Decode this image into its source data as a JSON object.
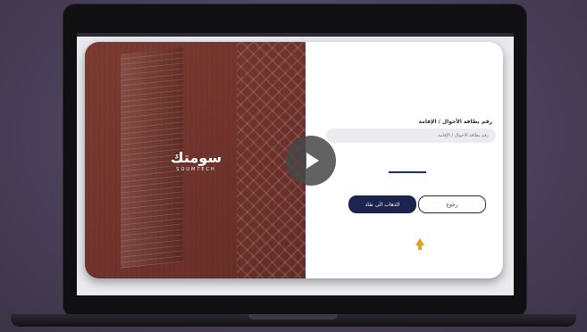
{
  "brand": {
    "name_ar": "سومتك",
    "name_en": "SOUMTECH"
  },
  "video": {
    "play_icon": "play-icon"
  },
  "form": {
    "field_label": "رقم بطاقة الأحوال / الإقامة",
    "field_placeholder": "رقم بطاقة الأحوال / الإقامة",
    "back_label": "رجوع",
    "nafath_label": "الذهاب الى نفاذ"
  },
  "colors": {
    "navy": "#1c2550",
    "accent_arrow": "#e0a020",
    "hero_overlay": "#7b3f35"
  }
}
